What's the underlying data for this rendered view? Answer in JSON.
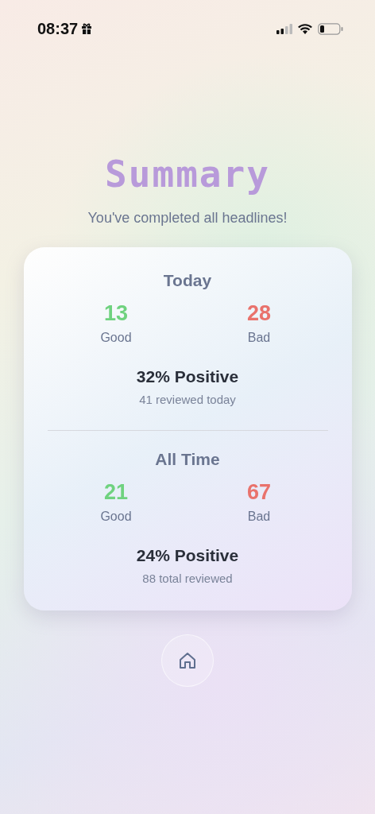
{
  "status_bar": {
    "time": "08:37"
  },
  "title": "Summary",
  "subtitle": "You've completed all headlines!",
  "sections": [
    {
      "heading": "Today",
      "good": {
        "value": "13",
        "label": "Good"
      },
      "bad": {
        "value": "28",
        "label": "Bad"
      },
      "positive": "32% Positive",
      "reviewed": "41 reviewed today"
    },
    {
      "heading": "All Time",
      "good": {
        "value": "21",
        "label": "Good"
      },
      "bad": {
        "value": "67",
        "label": "Bad"
      },
      "positive": "24% Positive",
      "reviewed": "88 total reviewed"
    }
  ]
}
